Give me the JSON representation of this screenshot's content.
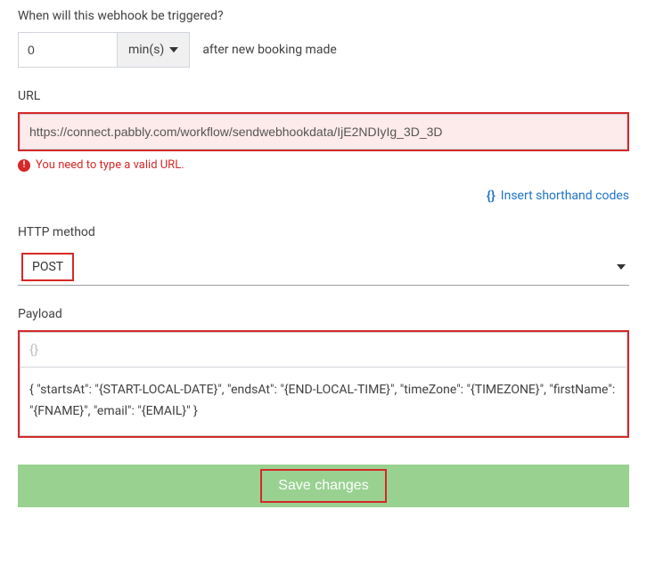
{
  "trigger": {
    "question": "When will this webhook be triggered?",
    "value": "0",
    "unit": "min(s)",
    "suffix": "after new booking made"
  },
  "url": {
    "label": "URL",
    "value": "https://connect.pabbly.com/workflow/sendwebhookdata/IjE2NDIyIg_3D_3D",
    "error": "You need to type a valid URL."
  },
  "shorthand": {
    "icon": "{}",
    "label": "Insert shorthand codes"
  },
  "method": {
    "label": "HTTP method",
    "value": "POST"
  },
  "payload": {
    "label": "Payload",
    "placeholder": "{}",
    "content": "{ \"startsAt\": \"{START-LOCAL-DATE}\", \"endsAt\": \"{END-LOCAL-TIME}\", \"timeZone\": \"{TIMEZONE}\", \"firstName\": \"{FNAME}\", \"email\": \"{EMAIL}\" }"
  },
  "save": {
    "label": "Save changes"
  }
}
